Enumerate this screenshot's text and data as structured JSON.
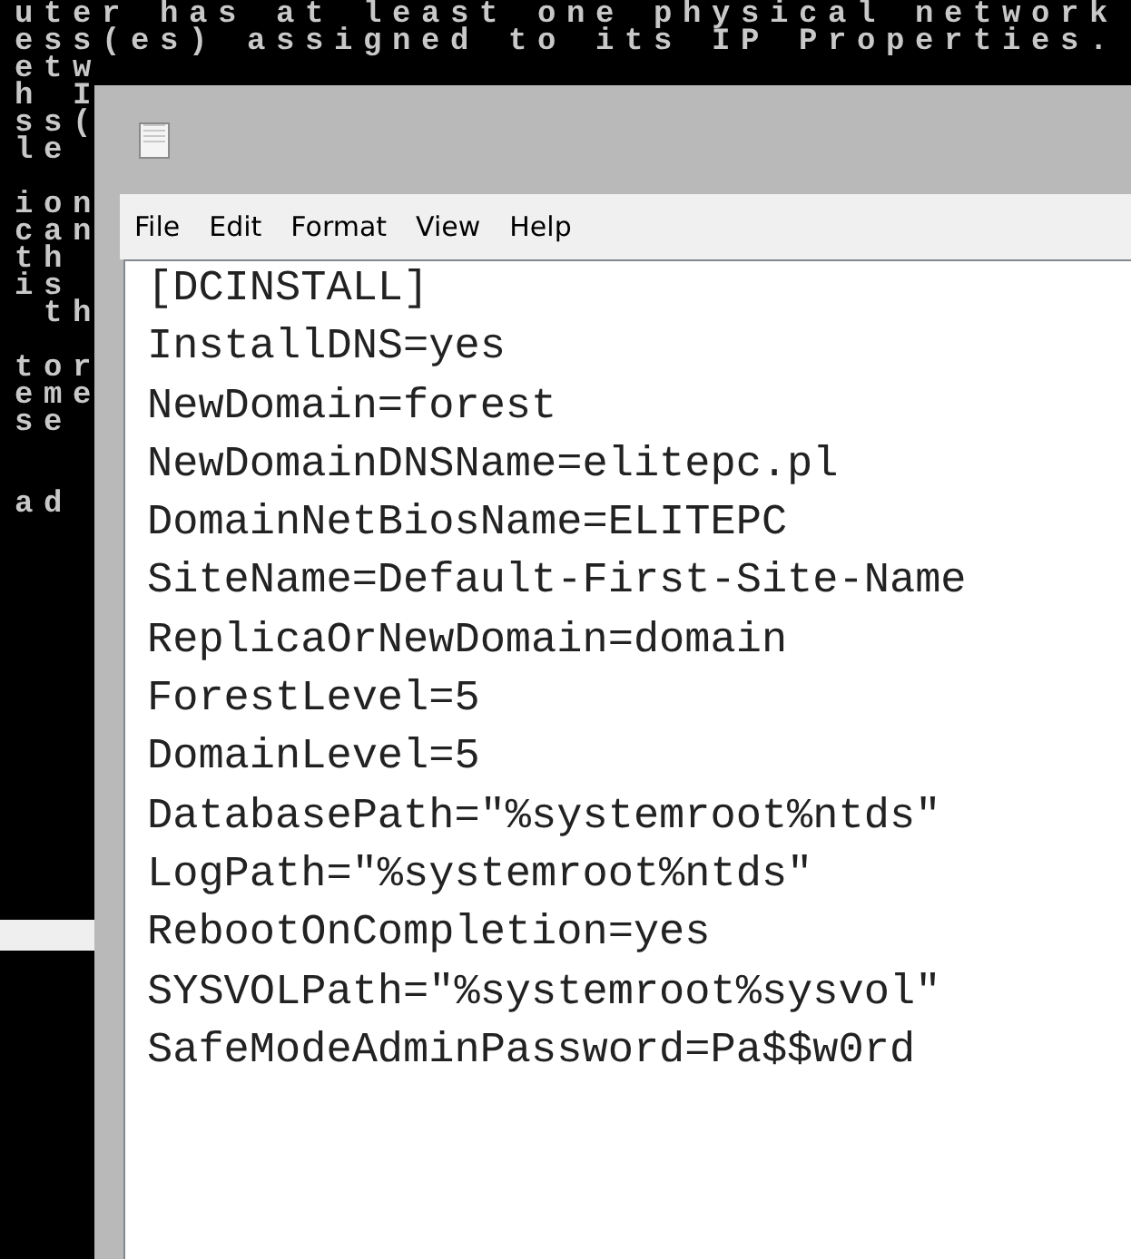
{
  "console": {
    "blocks": [
      {
        "lines": [
          "uter has at least one physical network",
          "ess(es) assigned to its IP Properties.",
          "etw",
          "h I",
          "ss(",
          "le"
        ]
      },
      {
        "lines": [
          "ion",
          "can",
          "th",
          "is",
          " th"
        ]
      },
      {
        "lines": [
          "tor",
          "eme",
          "se"
        ]
      },
      {
        "lines": [
          "ad"
        ],
        "wide_gap": true
      }
    ]
  },
  "notepad": {
    "menu": [
      "File",
      "Edit",
      "Format",
      "View",
      "Help"
    ],
    "lines": [
      "[DCINSTALL]",
      "InstallDNS=yes",
      "NewDomain=forest",
      "NewDomainDNSName=elitepc.pl",
      "DomainNetBiosName=ELITEPC",
      "SiteName=Default-First-Site-Name",
      "ReplicaOrNewDomain=domain",
      "ForestLevel=5",
      "DomainLevel=5",
      "DatabasePath=\"%systemroot%ntds\"",
      "LogPath=\"%systemroot%ntds\"",
      "RebootOnCompletion=yes",
      "SYSVOLPath=\"%systemroot%sysvol\"",
      "SafeModeAdminPassword=Pa$$w0rd"
    ]
  }
}
